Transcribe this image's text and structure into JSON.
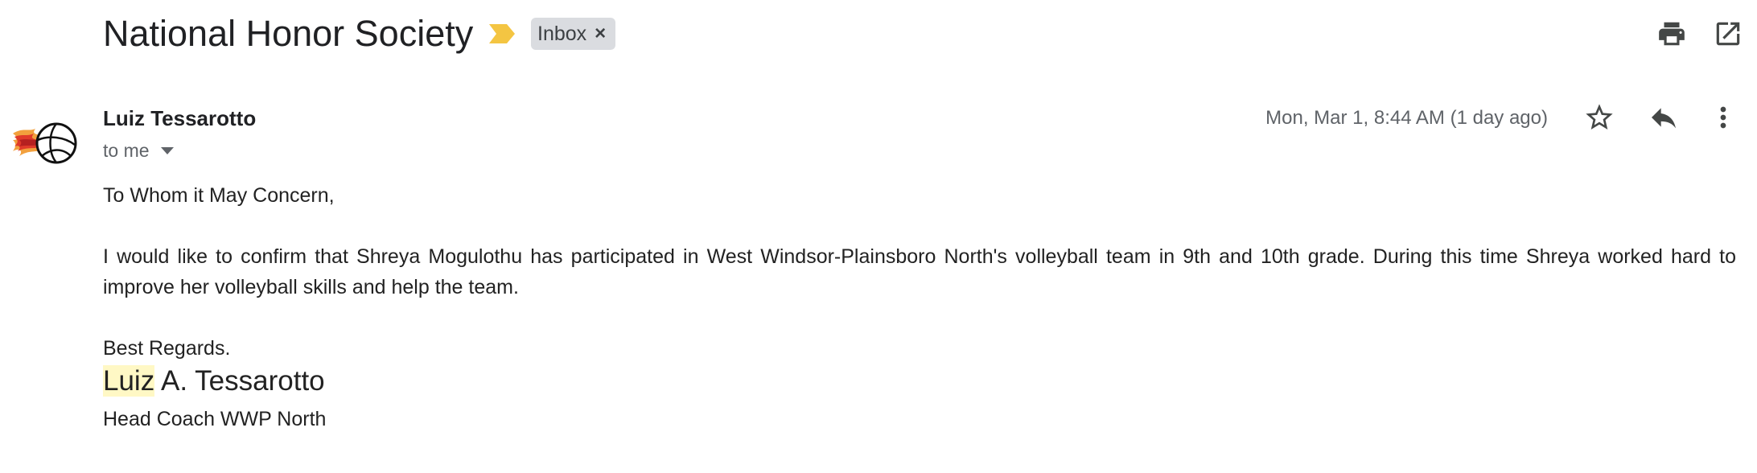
{
  "subject": "National Honor Society",
  "label": "Inbox",
  "label_close": "×",
  "sender": {
    "name": "Luiz Tessarotto",
    "recipient": "to me"
  },
  "date": "Mon, Mar 1, 8:44 AM (1 day ago)",
  "body": {
    "greeting": "To Whom it May Concern,",
    "paragraph": "I would like to confirm that Shreya Mogulothu has participated in West Windsor-Plainsboro North's volleyball team in 9th and 10th grade. During this time Shreya worked hard to improve her volleyball skills and help the team.",
    "closing": "Best Regards.",
    "signature_highlight": "Luiz",
    "signature_rest": " A. Tessarotto",
    "signature_title": "Head Coach WWP North"
  },
  "icons": {
    "importance": "importance-marker-icon",
    "print": "print-icon",
    "open_new": "open-in-new-window-icon",
    "star": "star-icon",
    "reply": "reply-icon",
    "more": "more-vertical-icon"
  },
  "colors": {
    "importance": "#f4c542",
    "chip": "#dadce0",
    "highlight": "#fff8c5"
  }
}
